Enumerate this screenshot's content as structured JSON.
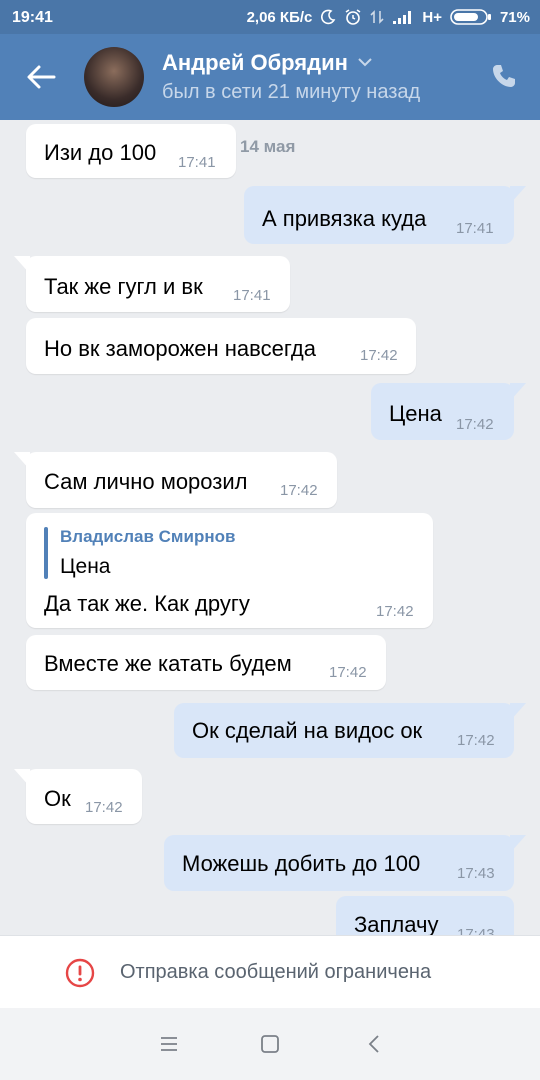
{
  "status_bar": {
    "time": "19:41",
    "speed": "2,06 КБ/с",
    "network": "H+",
    "battery": "71%"
  },
  "header": {
    "name": "Андрей Обрядин",
    "status": "был в сети 21 минуту назад",
    "back_icon": "arrow-left",
    "call_icon": "phone"
  },
  "date_label": "14 мая",
  "messages": [
    {
      "dir": "in",
      "text": "Изи до 100",
      "time": "17:41"
    },
    {
      "dir": "out",
      "text": "А привязка куда",
      "time": "17:41"
    },
    {
      "dir": "in",
      "text": "Так же гугл и вк",
      "time": "17:41"
    },
    {
      "dir": "in",
      "text": "Но вк заморожен навсегда",
      "time": "17:42"
    },
    {
      "dir": "out",
      "text": "Цена",
      "time": "17:42"
    },
    {
      "dir": "in",
      "text": "Сам лично морозил",
      "time": "17:42"
    },
    {
      "dir": "in",
      "quote_author": "Владислав Смирнов",
      "quote_text": "Цена",
      "text": "Да так же. Как другу",
      "time": "17:42"
    },
    {
      "dir": "in",
      "text": "Вместе же катать будем",
      "time": "17:42"
    },
    {
      "dir": "out",
      "text": "Ок сделай на видос ок",
      "time": "17:42"
    },
    {
      "dir": "in",
      "text": "Ок",
      "time": "17:42"
    },
    {
      "dir": "out",
      "text": "Можешь добить до 100",
      "time": "17:43"
    },
    {
      "dir": "out",
      "text": "Заплачу",
      "time": "17:43"
    }
  ],
  "restriction": {
    "text": "Отправка сообщений ограничена",
    "icon": "warning-circle",
    "color": "#e64646"
  },
  "colors": {
    "header": "#5181b8",
    "status_bar": "#4a76a8",
    "outgoing": "#d9e6f8",
    "incoming": "#ffffff",
    "background": "#ebedf0"
  }
}
